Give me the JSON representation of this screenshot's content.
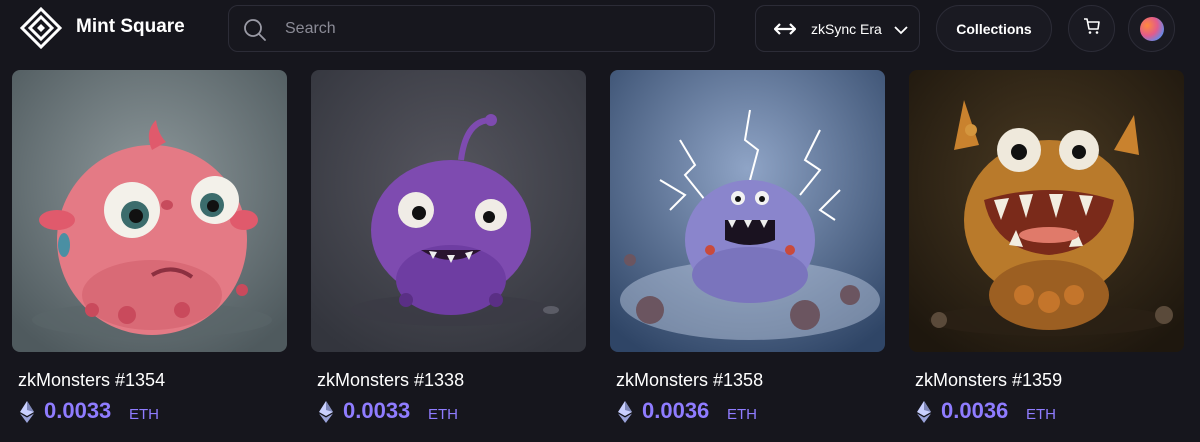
{
  "header": {
    "brand": "Mint Square",
    "search_placeholder": "Search",
    "network": "zkSync Era",
    "collections_label": "Collections"
  },
  "colors": {
    "background": "#16161d",
    "price_accent": "#8f7cff"
  },
  "icons": {
    "logo": "mint-square-logo",
    "search": "search-icon",
    "network_switch": "swap-arrows-icon",
    "dropdown": "chevron-down-icon",
    "cart": "cart-icon",
    "currency": "ethereum-icon"
  },
  "items": [
    {
      "name": "zkMonsters #1354",
      "price": "0.0033",
      "unit": "ETH",
      "art_colors": [
        "#6f7b80",
        "#e47a85"
      ]
    },
    {
      "name": "zkMonsters #1338",
      "price": "0.0033",
      "unit": "ETH",
      "art_colors": [
        "#3d3f4c",
        "#7e4bb0"
      ]
    },
    {
      "name": "zkMonsters #1358",
      "price": "0.0036",
      "unit": "ETH",
      "art_colors": [
        "#3d5a82",
        "#8a85cc"
      ]
    },
    {
      "name": "zkMonsters #1359",
      "price": "0.0036",
      "unit": "ETH",
      "art_colors": [
        "#3b2b1a",
        "#c9822e"
      ]
    }
  ]
}
